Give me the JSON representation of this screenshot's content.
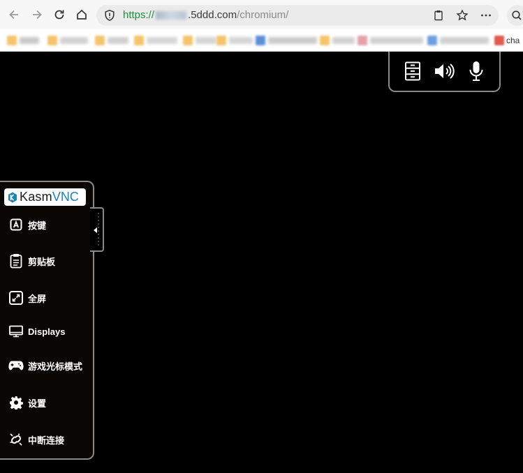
{
  "browser": {
    "url_scheme": "https://",
    "url_host_visible": ".5ddd.com",
    "url_path": "/chromium/",
    "bookmark_last_label": "cha"
  },
  "kasm": {
    "logo_kasm": "Kasm",
    "logo_vnc": "VNC",
    "menu": [
      {
        "label": "按键",
        "icon": "keyboard-a-icon"
      },
      {
        "label": "剪贴板",
        "icon": "clipboard-icon"
      },
      {
        "label": "全屏",
        "icon": "fullscreen-icon"
      },
      {
        "label": "Displays",
        "icon": "monitor-icon"
      },
      {
        "label": "游戏光标模式",
        "icon": "gamepad-icon"
      },
      {
        "label": "设置",
        "icon": "gear-icon"
      },
      {
        "label": "中断连接",
        "icon": "disconnect-icon"
      }
    ],
    "top_panel_icons": [
      "file-cabinet-icon",
      "speaker-icon",
      "microphone-icon"
    ]
  },
  "colors": {
    "url_scheme": "#1e8e3e",
    "vnc_accent": "#1b82b8",
    "panel_border": "#8a8a8a"
  }
}
